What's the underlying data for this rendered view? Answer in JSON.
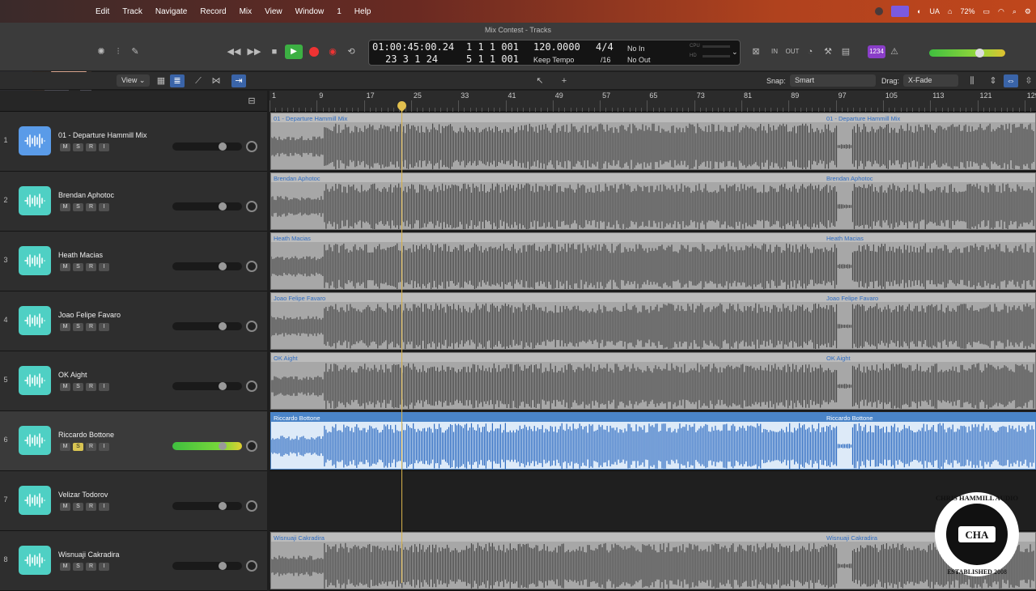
{
  "menubar": {
    "items": [
      "Edit",
      "Track",
      "Navigate",
      "Record",
      "Mix",
      "View",
      "Window",
      "1",
      "Help"
    ],
    "status": {
      "ua": "UA",
      "battery": "72%"
    }
  },
  "window": {
    "title": "Mix Contest - Tracks"
  },
  "lcd": {
    "smpte": "01:00:45:00.24",
    "smpte_sub": "23  3  1  24",
    "bars": "1  1  1  001",
    "bars_sub": "5  1  1  001",
    "tempo": "120.0000",
    "tempo_mode": "Keep Tempo",
    "signature": "4/4",
    "division": "/16",
    "midi_in": "No In",
    "midi_out": "No Out",
    "cpu_label": "CPU",
    "hd_label": "HD"
  },
  "toolbar": {
    "view_label": "View",
    "snap_label": "Snap:",
    "snap_value": "Smart",
    "drag_label": "Drag:",
    "drag_value": "X-Fade",
    "badge": "1234"
  },
  "ruler": {
    "bars": [
      "1",
      "9",
      "17",
      "25",
      "33",
      "41",
      "49",
      "57",
      "65",
      "73",
      "81",
      "89",
      "97",
      "105",
      "113",
      "121",
      "129"
    ]
  },
  "tracks": [
    {
      "num": "1",
      "name": "01 - Departure Hammill Mix",
      "region": "01 - Departure Hammill Mix",
      "icon": "waveform-icon",
      "color": "#5a9be8",
      "solo": false,
      "selected": false,
      "empty": false
    },
    {
      "num": "2",
      "name": "Brendan Aphotoc",
      "region": "Brendan Aphotoc",
      "icon": "waveform-icon",
      "color": "#4fd0c4",
      "solo": false,
      "selected": false,
      "empty": false
    },
    {
      "num": "3",
      "name": "Heath Macias",
      "region": "Heath Macias",
      "icon": "waveform-icon",
      "color": "#4fd0c4",
      "solo": false,
      "selected": false,
      "empty": false
    },
    {
      "num": "4",
      "name": "Joao Felipe Favaro",
      "region": "Joao Felipe Favaro",
      "icon": "waveform-icon",
      "color": "#4fd0c4",
      "solo": false,
      "selected": false,
      "empty": false
    },
    {
      "num": "5",
      "name": "OK Aight",
      "region": "OK Aight",
      "icon": "waveform-icon",
      "color": "#4fd0c4",
      "solo": false,
      "selected": false,
      "empty": false
    },
    {
      "num": "6",
      "name": "Riccardo Bottone",
      "region": "Riccardo Bottone",
      "icon": "waveform-icon",
      "color": "#4fd0c4",
      "solo": true,
      "selected": true,
      "empty": false
    },
    {
      "num": "7",
      "name": "Velizar Todorov",
      "region": "",
      "icon": "waveform-icon",
      "color": "#4fd0c4",
      "solo": false,
      "selected": false,
      "empty": true
    },
    {
      "num": "8",
      "name": "Wisnuaji Cakradira",
      "region": "Wisnuaji Cakradira",
      "icon": "waveform-icon",
      "color": "#4fd0c4",
      "solo": false,
      "selected": false,
      "empty": false
    }
  ],
  "msri_labels": [
    "M",
    "S",
    "R",
    "I"
  ],
  "watermark": {
    "text": "CHRIS HAMMILL AUDIO",
    "initials": "CHA",
    "sub": "ESTABLISHED 2008"
  }
}
